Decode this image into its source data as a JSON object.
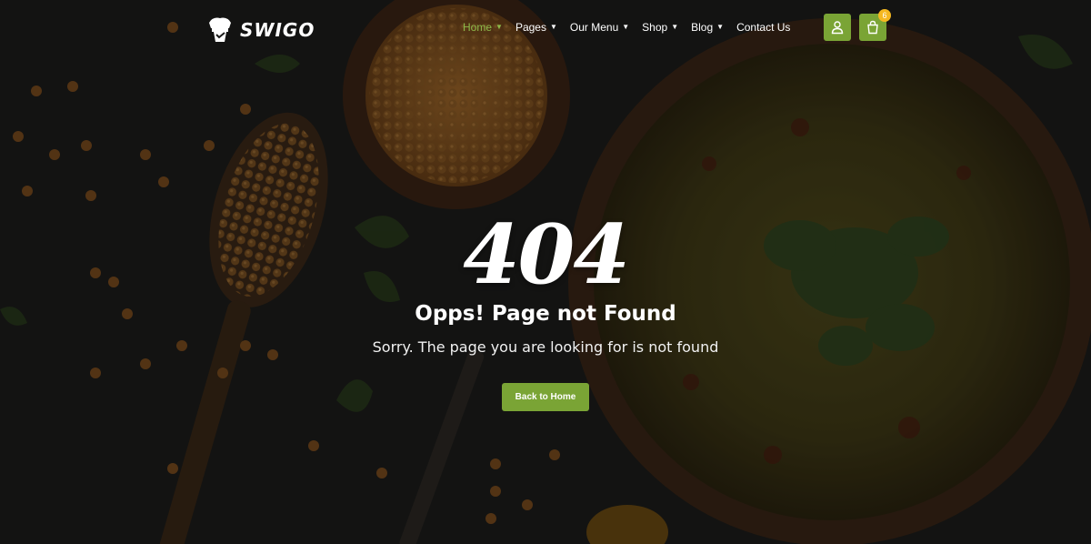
{
  "brand": {
    "name": "SWIGO"
  },
  "nav": {
    "items": [
      {
        "label": "Home",
        "active": true,
        "dropdown": true
      },
      {
        "label": "Pages",
        "active": false,
        "dropdown": true
      },
      {
        "label": "Our Menu",
        "active": false,
        "dropdown": true
      },
      {
        "label": "Shop",
        "active": false,
        "dropdown": true
      },
      {
        "label": "Blog",
        "active": false,
        "dropdown": true
      },
      {
        "label": "Contact Us",
        "active": false,
        "dropdown": false
      }
    ]
  },
  "header_actions": {
    "user_icon": "user-icon",
    "cart_icon": "shopping-bag-icon",
    "cart_count": "6"
  },
  "error": {
    "code": "404",
    "title": "Opps! Page not Found",
    "message": "Sorry. The page you are looking for is not found",
    "button_label": "Back to Home"
  },
  "colors": {
    "accent": "#7aa435",
    "active_nav": "#8dba4a",
    "badge": "#f5b820",
    "background": "#1c1c1b"
  }
}
